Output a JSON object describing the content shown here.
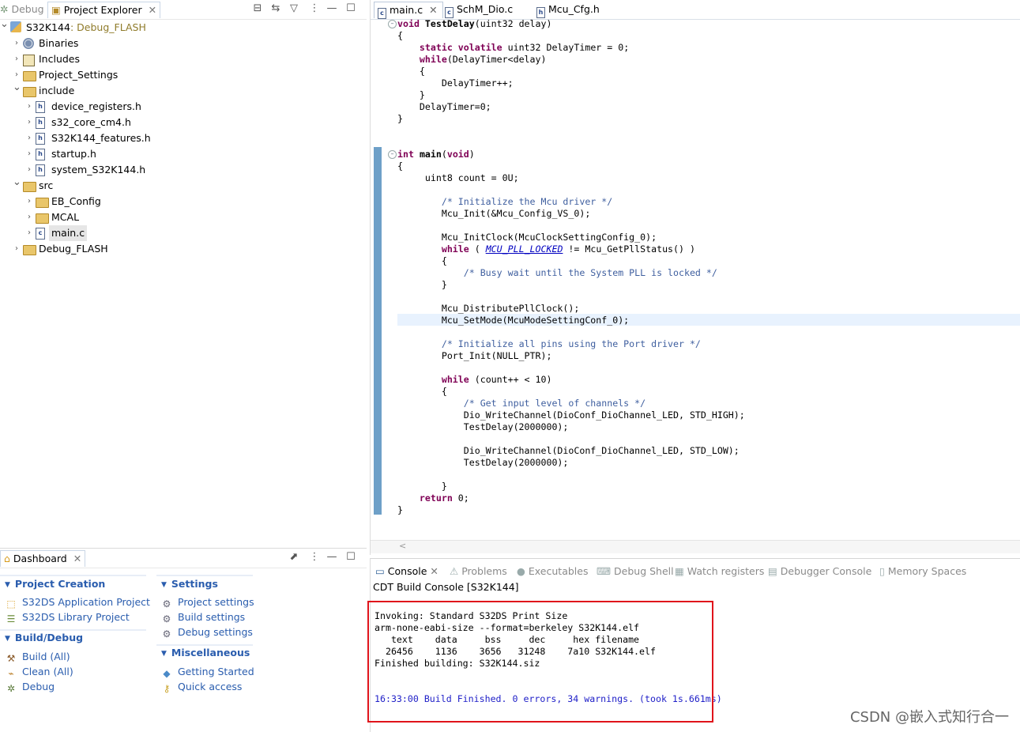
{
  "explorer": {
    "tab_debug": "Debug",
    "tab_project_explorer": "Project Explorer",
    "tree": [
      {
        "label": "S32K144",
        "decor": ": Debug_FLASH",
        "depth": 0,
        "expanded": true,
        "icon": "project-icon"
      },
      {
        "label": "Binaries",
        "depth": 1,
        "expanded": false,
        "icon": "binaries-icon"
      },
      {
        "label": "Includes",
        "depth": 1,
        "expanded": false,
        "icon": "includes-icon"
      },
      {
        "label": "Project_Settings",
        "depth": 1,
        "expanded": false,
        "icon": "folder-icon"
      },
      {
        "label": "include",
        "depth": 1,
        "expanded": true,
        "icon": "folder-icon"
      },
      {
        "label": "device_registers.h",
        "depth": 2,
        "expanded": false,
        "icon": "header-file-icon"
      },
      {
        "label": "s32_core_cm4.h",
        "depth": 2,
        "expanded": false,
        "icon": "header-file-icon"
      },
      {
        "label": "S32K144_features.h",
        "depth": 2,
        "expanded": false,
        "icon": "header-file-icon"
      },
      {
        "label": "startup.h",
        "depth": 2,
        "expanded": false,
        "icon": "header-file-icon"
      },
      {
        "label": "system_S32K144.h",
        "depth": 2,
        "expanded": false,
        "icon": "header-file-icon"
      },
      {
        "label": "src",
        "depth": 1,
        "expanded": true,
        "icon": "source-folder-icon"
      },
      {
        "label": "EB_Config",
        "depth": 2,
        "expanded": false,
        "icon": "folder-icon"
      },
      {
        "label": "MCAL",
        "depth": 2,
        "expanded": false,
        "icon": "folder-icon"
      },
      {
        "label": "main.c",
        "depth": 2,
        "expanded": false,
        "icon": "c-file-icon",
        "selected": true
      },
      {
        "label": "Debug_FLASH",
        "depth": 1,
        "expanded": false,
        "icon": "folder-icon"
      }
    ]
  },
  "editor": {
    "tabs": [
      {
        "label": "main.c",
        "icon": "c",
        "active": true
      },
      {
        "label": "SchM_Dio.c",
        "icon": "c",
        "active": false
      },
      {
        "label": "Mcu_Cfg.h",
        "icon": "h",
        "active": false
      }
    ],
    "lines": [
      "void TestDelay(uint32 delay)",
      "{",
      "    static volatile uint32 DelayTimer = 0;",
      "    while(DelayTimer<delay)",
      "    {",
      "        DelayTimer++;",
      "    }",
      "    DelayTimer=0;",
      "}",
      "",
      "",
      "int main(void)",
      "{",
      "     uint8 count = 0U;",
      "",
      "        /* Initialize the Mcu driver */",
      "        Mcu_Init(&Mcu_Config_VS_0);",
      "",
      "        Mcu_InitClock(McuClockSettingConfig_0);",
      "        while ( MCU_PLL_LOCKED != Mcu_GetPllStatus() )",
      "        {",
      "            /* Busy wait until the System PLL is locked */",
      "        }",
      "",
      "        Mcu_DistributePllClock();",
      "        Mcu_SetMode(McuModeSettingConf_0);",
      "",
      "        /* Initialize all pins using the Port driver */",
      "        Port_Init(NULL_PTR);",
      "",
      "        while (count++ < 10)",
      "        {",
      "            /* Get input level of channels */",
      "            Dio_WriteChannel(DioConf_DioChannel_LED, STD_HIGH);",
      "            TestDelay(2000000);",
      "",
      "            Dio_WriteChannel(DioConf_DioChannel_LED, STD_LOW);",
      "            TestDelay(2000000);",
      "",
      "        }",
      "    return 0;",
      "}"
    ]
  },
  "dashboard": {
    "tab": "Dashboard",
    "project_creation": {
      "title": "Project Creation",
      "items": [
        "S32DS Application Project",
        "S32DS Library Project"
      ]
    },
    "build_debug": {
      "title": "Build/Debug",
      "items": [
        "Build  (All)",
        "Clean  (All)",
        "Debug"
      ]
    },
    "settings": {
      "title": "Settings",
      "items": [
        "Project settings",
        "Build settings",
        "Debug settings"
      ]
    },
    "misc": {
      "title": "Miscellaneous",
      "items": [
        "Getting Started",
        "Quick access"
      ]
    }
  },
  "console": {
    "tabs": [
      "Console",
      "Problems",
      "Executables",
      "Debug Shell",
      "Watch registers",
      "Debugger Console",
      "Memory Spaces"
    ],
    "header": "CDT Build Console [S32K144]",
    "output": [
      "Invoking: Standard S32DS Print Size",
      "arm-none-eabi-size --format=berkeley S32K144.elf",
      "   text    data     bss     dec     hex filename",
      "  26456    1136    3656   31248    7a10 S32K144.elf",
      "Finished building: S32K144.siz"
    ],
    "status": "16:33:00 Build Finished. 0 errors, 34 warnings. (took 1s.661ms)"
  },
  "watermark": "CSDN @嵌入式知行合一"
}
